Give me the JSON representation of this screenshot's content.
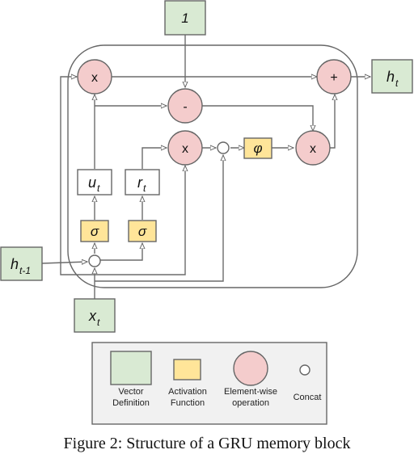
{
  "diagram": {
    "title": "GRU memory block",
    "inputs": {
      "one": "1",
      "h_prev": {
        "base": "h",
        "sub": "t-1"
      },
      "x": {
        "base": "x",
        "sub": "t"
      }
    },
    "output": {
      "base": "h",
      "sub": "t"
    },
    "gates": {
      "update": {
        "base": "u",
        "sub": "t"
      },
      "reset": {
        "base": "r",
        "sub": "t"
      }
    },
    "activations": {
      "sigma_update": "σ",
      "sigma_reset": "σ",
      "phi": "φ"
    },
    "ops": {
      "mult_top": "x",
      "minus": "-",
      "mult_reset": "x",
      "mult_candidate": "x",
      "plus": "+"
    }
  },
  "legend": {
    "items": [
      {
        "label_line1": "Vector",
        "label_line2": "Definition"
      },
      {
        "label_line1": "Activation",
        "label_line2": "Function"
      },
      {
        "label_line1": "Element-wise",
        "label_line2": "operation"
      },
      {
        "label_line1": "Concat",
        "label_line2": ""
      }
    ]
  },
  "colors": {
    "vector": "#d9ead3",
    "activation": "#ffe599",
    "operation": "#f4cccc",
    "stroke": "#666666"
  },
  "caption": "Figure 2: Structure of a GRU memory block"
}
